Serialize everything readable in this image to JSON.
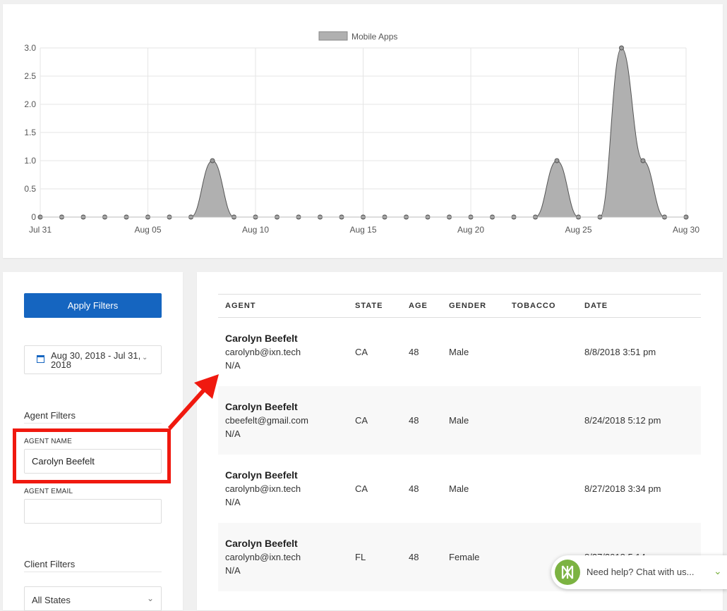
{
  "chart": {
    "legend_label": "Mobile Apps",
    "series_color": "#b0b0b0",
    "x_ticks": [
      "Jul 31",
      "Aug 05",
      "Aug 10",
      "Aug 15",
      "Aug 20",
      "Aug 25",
      "Aug 30"
    ],
    "y_ticks": [
      "3.0",
      "2.5",
      "2.0",
      "1.5",
      "1.0",
      "0.5",
      "0"
    ]
  },
  "chart_data": {
    "type": "area",
    "title": "",
    "xlabel": "",
    "ylabel": "",
    "legend": "top-center",
    "grid": true,
    "ylim": [
      0,
      3
    ],
    "x": [
      "Jul 31",
      "Aug 01",
      "Aug 02",
      "Aug 03",
      "Aug 04",
      "Aug 05",
      "Aug 06",
      "Aug 07",
      "Aug 08",
      "Aug 09",
      "Aug 10",
      "Aug 11",
      "Aug 12",
      "Aug 13",
      "Aug 14",
      "Aug 15",
      "Aug 16",
      "Aug 17",
      "Aug 18",
      "Aug 19",
      "Aug 20",
      "Aug 21",
      "Aug 22",
      "Aug 23",
      "Aug 24",
      "Aug 25",
      "Aug 26",
      "Aug 27",
      "Aug 28",
      "Aug 29",
      "Aug 30"
    ],
    "series": [
      {
        "name": "Mobile Apps",
        "values": [
          0,
          0,
          0,
          0,
          0,
          0,
          0,
          0,
          1,
          0,
          0,
          0,
          0,
          0,
          0,
          0,
          0,
          0,
          0,
          0,
          0,
          0,
          0,
          0,
          1,
          0,
          0,
          3,
          1,
          0,
          0
        ]
      }
    ]
  },
  "filters": {
    "apply_label": "Apply Filters",
    "date_range": "Aug 30, 2018 - Jul 31, 2018",
    "agent_section": "Agent Filters",
    "agent_name_label": "AGENT NAME",
    "agent_name_value": "Carolyn Beefelt",
    "agent_email_label": "AGENT EMAIL",
    "agent_email_value": "",
    "client_section": "Client Filters",
    "state_select": "All States"
  },
  "table": {
    "headers": [
      "AGENT",
      "STATE",
      "AGE",
      "GENDER",
      "TOBACCO",
      "DATE"
    ],
    "rows": [
      {
        "name": "Carolyn Beefelt",
        "email": "carolynb@ixn.tech",
        "extra": "N/A",
        "state": "CA",
        "age": "48",
        "gender": "Male",
        "tobacco": "",
        "date": "8/8/2018 3:51 pm"
      },
      {
        "name": "Carolyn Beefelt",
        "email": "cbeefelt@gmail.com",
        "extra": "N/A",
        "state": "CA",
        "age": "48",
        "gender": "Male",
        "tobacco": "",
        "date": "8/24/2018 5:12 pm"
      },
      {
        "name": "Carolyn Beefelt",
        "email": "carolynb@ixn.tech",
        "extra": "N/A",
        "state": "CA",
        "age": "48",
        "gender": "Male",
        "tobacco": "",
        "date": "8/27/2018 3:34 pm"
      },
      {
        "name": "Carolyn Beefelt",
        "email": "carolynb@ixn.tech",
        "extra": "N/A",
        "state": "FL",
        "age": "48",
        "gender": "Female",
        "tobacco": "",
        "date": "8/27/2018 5:14 pm"
      }
    ]
  },
  "chat": {
    "text": "Need help? Chat with us..."
  },
  "colors": {
    "primary": "#1565c0",
    "annotation": "#f0190f",
    "chat_brand": "#7cb342"
  }
}
